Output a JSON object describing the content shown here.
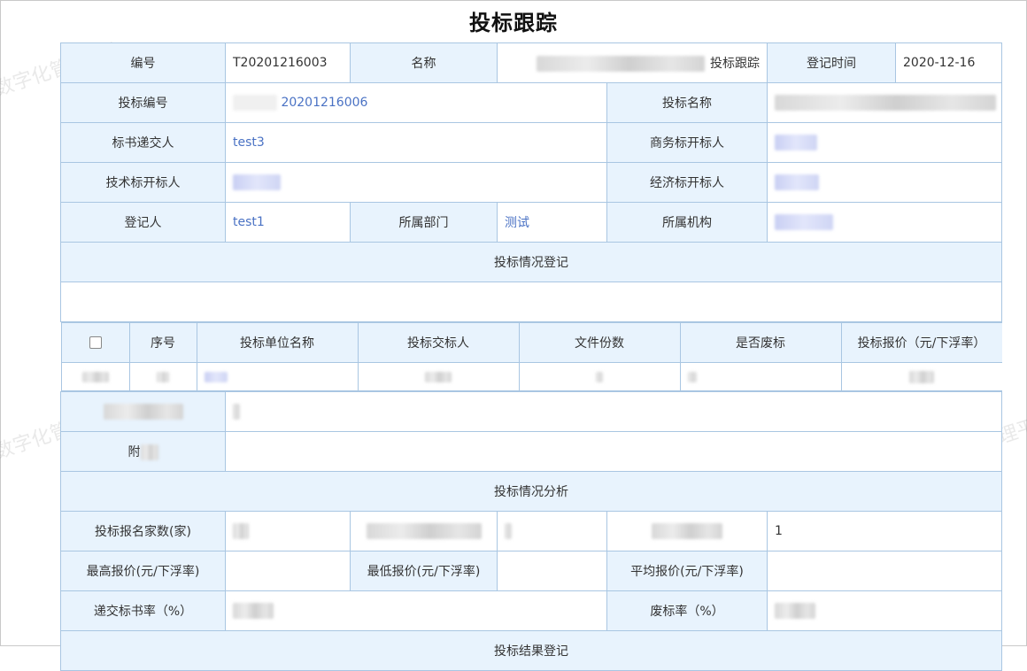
{
  "page_title": "投标跟踪",
  "watermark": "数字化管理平台",
  "row1": {
    "code_label": "编号",
    "code_value": "T20201216003",
    "name_label": "名称",
    "name_value": "投标跟踪",
    "date_label": "登记时间",
    "date_value": "2020-12-16"
  },
  "row2": {
    "bid_code_label": "投标编号",
    "bid_code_value": "20201216006",
    "bid_name_label": "投标名称"
  },
  "row3": {
    "submitter_label": "标书递交人",
    "submitter_value": "test3",
    "biz_opener_label": "商务标开标人"
  },
  "row4": {
    "tech_opener_label": "技术标开标人",
    "econ_opener_label": "经济标开标人"
  },
  "row5": {
    "registrar_label": "登记人",
    "registrar_value": "test1",
    "dept_label": "所属部门",
    "dept_value": "测试",
    "org_label": "所属机构"
  },
  "section1": {
    "title": "投标情况登记"
  },
  "bid_table": {
    "headers": [
      "序号",
      "投标单位名称",
      "投标交标人",
      "文件份数",
      "是否废标",
      "投标报价（元/下浮率）"
    ]
  },
  "row_attach": {
    "label": "附"
  },
  "section2": {
    "title": "投标情况分析"
  },
  "analysis": {
    "count_label": "投标报名家数(家)",
    "right_value": "1",
    "max_label": "最高报价(元/下浮率)",
    "min_label": "最低报价(元/下浮率)",
    "avg_label": "平均报价(元/下浮率)",
    "submit_rate_label": "递交标书率（%）",
    "waste_rate_label": "废标率（%）"
  },
  "section3": {
    "title": "投标结果登记"
  }
}
